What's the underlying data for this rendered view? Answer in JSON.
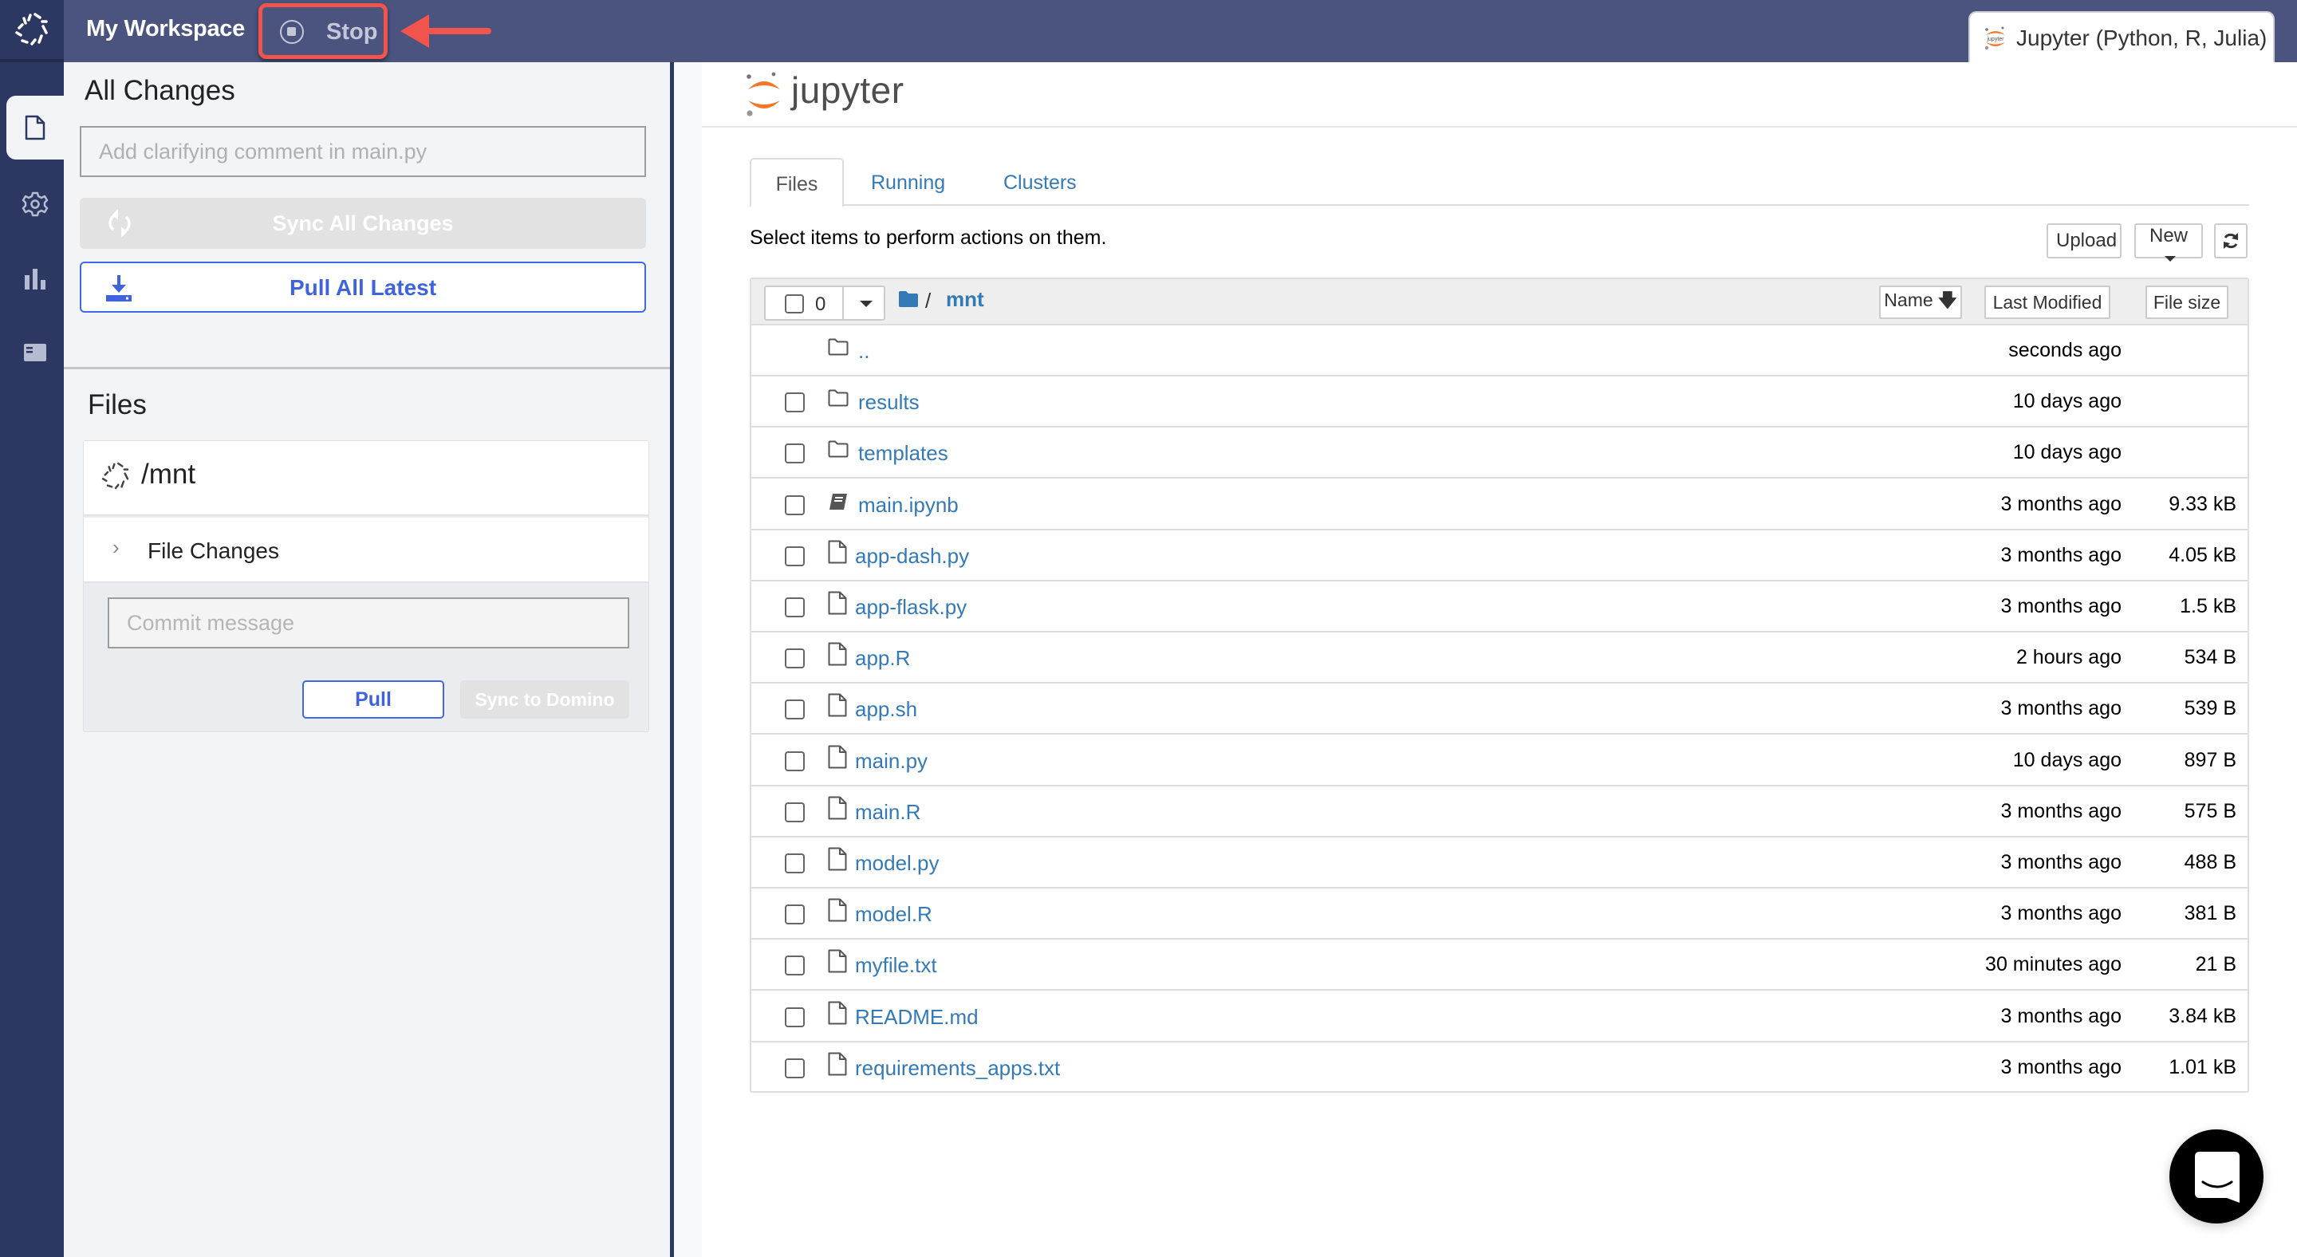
{
  "topbar": {
    "workspace_title": "My Workspace",
    "stop_label": "Stop",
    "app_tab_label": "Jupyter (Python, R, Julia)"
  },
  "rail": {
    "items": [
      {
        "icon": "file-icon",
        "active": true
      },
      {
        "icon": "gear-icon",
        "active": false
      },
      {
        "icon": "bar-chart-icon",
        "active": false
      },
      {
        "icon": "card-icon",
        "active": false
      }
    ]
  },
  "left_panel": {
    "all_changes_title": "All Changes",
    "comment_placeholder": "Add clarifying comment in main.py",
    "sync_all_label": "Sync All Changes",
    "pull_all_label": "Pull All Latest",
    "files_title": "Files",
    "repo": {
      "path": "/mnt",
      "file_changes_label": "File Changes",
      "commit_placeholder": "Commit message",
      "pull_label": "Pull",
      "sync_label": "Sync to Domino"
    }
  },
  "jupyter": {
    "logo_text": "jupyter",
    "tabs": [
      {
        "label": "Files",
        "active": true
      },
      {
        "label": "Running",
        "active": false
      },
      {
        "label": "Clusters",
        "active": false
      }
    ],
    "hint": "Select items to perform actions on them.",
    "toolbar": {
      "upload_label": "Upload",
      "new_label": "New",
      "refresh_icon": "refresh-icon"
    },
    "list_header": {
      "selected_count": "0",
      "breadcrumb_sep": "/",
      "breadcrumb_dir": "mnt",
      "sort_name": "Name",
      "sort_modified": "Last Modified",
      "sort_size": "File size"
    },
    "rows": [
      {
        "name": "..",
        "type": "parent",
        "modified": "seconds ago",
        "size": ""
      },
      {
        "name": "results",
        "type": "folder",
        "modified": "10 days ago",
        "size": ""
      },
      {
        "name": "templates",
        "type": "folder",
        "modified": "10 days ago",
        "size": ""
      },
      {
        "name": "main.ipynb",
        "type": "notebook",
        "modified": "3 months ago",
        "size": "9.33 kB"
      },
      {
        "name": "app-dash.py",
        "type": "file",
        "modified": "3 months ago",
        "size": "4.05 kB"
      },
      {
        "name": "app-flask.py",
        "type": "file",
        "modified": "3 months ago",
        "size": "1.5 kB"
      },
      {
        "name": "app.R",
        "type": "file",
        "modified": "2 hours ago",
        "size": "534 B"
      },
      {
        "name": "app.sh",
        "type": "file",
        "modified": "3 months ago",
        "size": "539 B"
      },
      {
        "name": "main.py",
        "type": "file",
        "modified": "10 days ago",
        "size": "897 B"
      },
      {
        "name": "main.R",
        "type": "file",
        "modified": "3 months ago",
        "size": "575 B"
      },
      {
        "name": "model.py",
        "type": "file",
        "modified": "3 months ago",
        "size": "488 B"
      },
      {
        "name": "model.R",
        "type": "file",
        "modified": "3 months ago",
        "size": "381 B"
      },
      {
        "name": "myfile.txt",
        "type": "file",
        "modified": "30 minutes ago",
        "size": "21 B"
      },
      {
        "name": "README.md",
        "type": "file",
        "modified": "3 months ago",
        "size": "3.84 kB"
      },
      {
        "name": "requirements_apps.txt",
        "type": "file",
        "modified": "3 months ago",
        "size": "1.01 kB"
      }
    ]
  },
  "colors": {
    "topbar": "#4b547f",
    "rail": "#2c3862",
    "annotation_red": "#f0544c",
    "primary_blue": "#4169e1",
    "link_blue": "#337ab7",
    "jupyter_orange": "#f37726"
  }
}
